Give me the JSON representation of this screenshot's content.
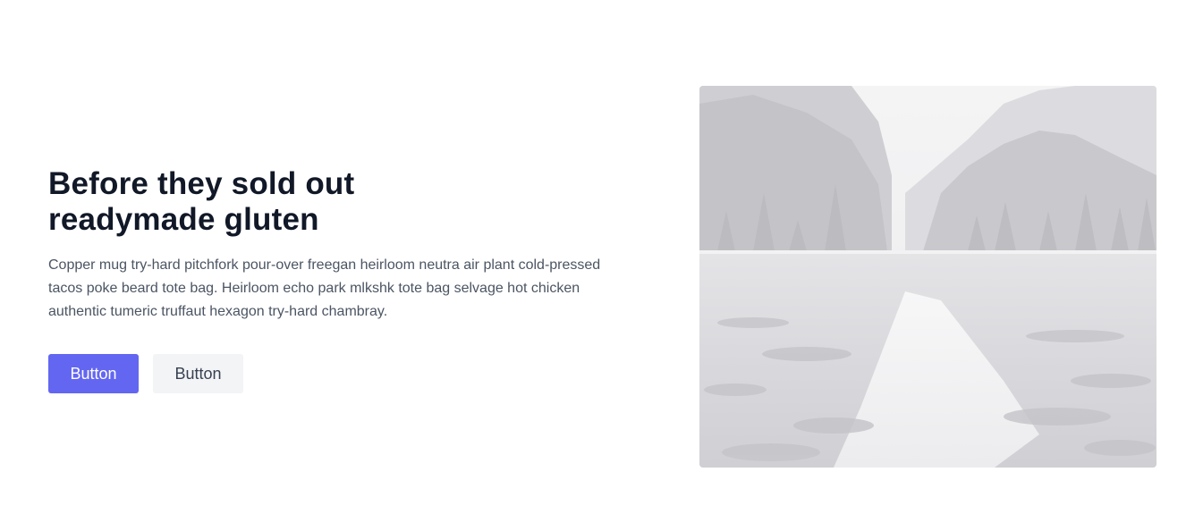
{
  "hero": {
    "title_lines": [
      "Before they sold out",
      "readymade gluten"
    ],
    "description_lines": [
      "Copper mug try-hard pitchfork pour-over freegan heirloom neutra air plant cold-pressed",
      "tacos poke beard tote bag. Heirloom echo park mlkshk tote bag selvage hot chicken",
      "authentic tumeric truffaut hexagon try-hard chambray."
    ],
    "primary_button": "Button",
    "secondary_button": "Button"
  },
  "colors": {
    "accent": "#6366f1",
    "secondary_bg": "#f3f4f6",
    "title": "#111827",
    "body_text": "#4b5563"
  },
  "image": {
    "subject": "grayscale mountain lake landscape with forested slopes and reflection"
  }
}
